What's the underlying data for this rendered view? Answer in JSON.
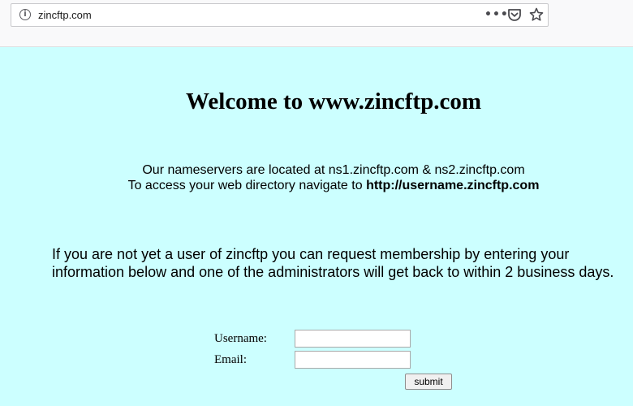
{
  "browser": {
    "url": "zincftp.com",
    "info_icon_glyph": "i",
    "more_icon_glyph": "•••"
  },
  "page": {
    "background_color": "#ccffff",
    "heading": "Welcome to www.zincftp.com",
    "nameservers_line": "Our nameservers are located at ns1.zincftp.com & ns2.zincftp.com",
    "directory_prefix": "To access your web directory navigate to ",
    "directory_url": "http://username.zincftp.com",
    "membership_text": "If you are not yet a user of zincftp you can request membership by entering your information below and one of the administrators will get back to within 2 business days."
  },
  "form": {
    "username_label": "Username:",
    "username_value": "",
    "email_label": "Email:",
    "email_value": "",
    "submit_label": "submit"
  }
}
